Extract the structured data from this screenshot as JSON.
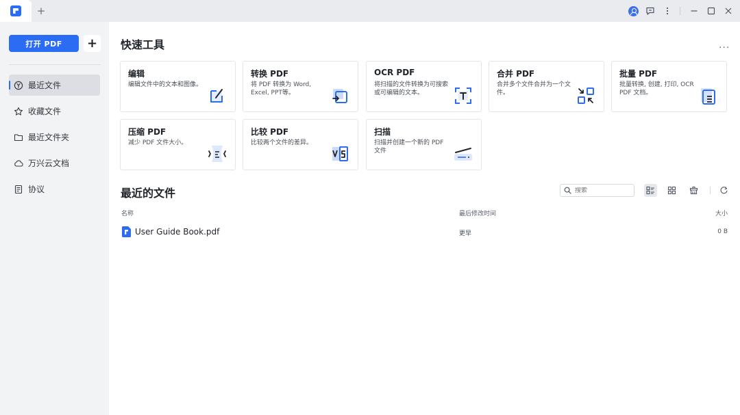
{
  "titlebar": {
    "new_tab_label": "+",
    "icons": [
      "app-logo-icon",
      "user-avatar-icon",
      "feedback-icon",
      "more-vertical-icon",
      "minimize-icon",
      "maximize-icon",
      "close-icon"
    ]
  },
  "sidebar": {
    "open_pdf_label": "打开 PDF",
    "add_label": "+",
    "items": [
      {
        "label": "最近文件",
        "icon": "clock-icon",
        "active": true
      },
      {
        "label": "收藏文件",
        "icon": "star-icon",
        "active": false
      },
      {
        "label": "最近文件夹",
        "icon": "folder-icon",
        "active": false
      },
      {
        "label": "万兴云文档",
        "icon": "cloud-icon",
        "active": false
      },
      {
        "label": "协议",
        "icon": "document-icon",
        "active": false
      }
    ]
  },
  "quick_tools": {
    "title": "快速工具",
    "more_label": "...",
    "cards": [
      {
        "title": "编辑",
        "desc": "编辑文件中的文本和图像。",
        "icon": "edit-icon"
      },
      {
        "title": "转换 PDF",
        "desc": "将 PDF 转换为 Word, Excel, PPT等。",
        "icon": "convert-icon"
      },
      {
        "title": "OCR PDF",
        "desc": "将扫描的文件转换为可搜索或可编辑的文本。",
        "icon": "ocr-icon"
      },
      {
        "title": "合并 PDF",
        "desc": "合并多个文件合并为一个文件。",
        "icon": "merge-icon"
      },
      {
        "title": "批量 PDF",
        "desc": "批量转换, 创建, 打印, OCR PDF 文档。",
        "icon": "batch-icon"
      },
      {
        "title": "压缩 PDF",
        "desc": "减少 PDF 文件大小。",
        "icon": "compress-icon"
      },
      {
        "title": "比较 PDF",
        "desc": "比较两个文件的差异。",
        "icon": "compare-icon"
      },
      {
        "title": "扫描",
        "desc": "扫描并创建一个新的 PDF 文件",
        "icon": "scan-icon"
      }
    ]
  },
  "recent_files": {
    "title": "最近的文件",
    "search_placeholder": "搜索",
    "columns": {
      "name": "名称",
      "modified": "最后修改时间",
      "size": "大小"
    },
    "rows": [
      {
        "name": "User Guide Book.pdf",
        "modified": "更早",
        "size": "0 B"
      }
    ],
    "view_icons": [
      "list-view-icon",
      "grid-view-icon",
      "trash-icon",
      "refresh-icon"
    ]
  },
  "colors": {
    "accent": "#2b6cf5",
    "sidebar_bg": "#f2f3f5",
    "titlebar_bg": "#e9ebef"
  }
}
